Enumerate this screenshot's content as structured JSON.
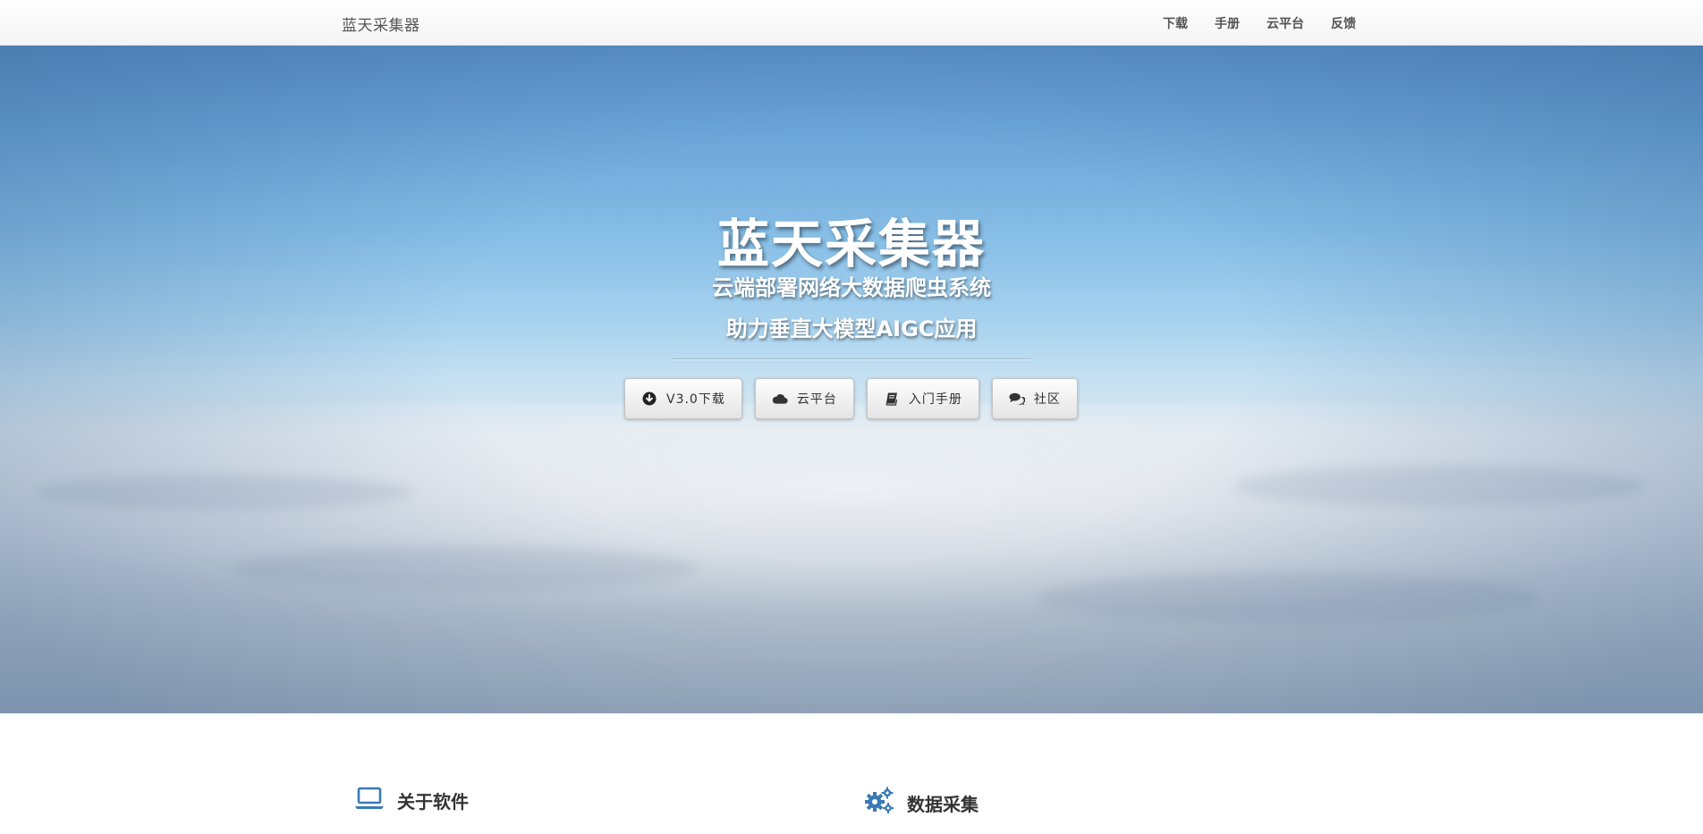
{
  "navbar": {
    "brand": "蓝天采集器",
    "links": [
      "下载",
      "手册",
      "云平台",
      "反馈"
    ]
  },
  "hero": {
    "title": "蓝天采集器",
    "subtitle1": "云端部署网络大数据爬虫系统",
    "subtitle2": "助力垂直大模型AIGC应用",
    "buttons": [
      {
        "label": "V3.0下载",
        "icon": "download-circle-icon"
      },
      {
        "label": "云平台",
        "icon": "cloud-icon"
      },
      {
        "label": "入门手册",
        "icon": "book-icon"
      },
      {
        "label": "社区",
        "icon": "comments-icon"
      }
    ]
  },
  "features": [
    {
      "title": "关于软件",
      "icon": "laptop-icon",
      "color": "#3a7ab5"
    },
    {
      "title": "数据采集",
      "icon": "gears-icon",
      "color": "#3a7ab5"
    }
  ]
}
